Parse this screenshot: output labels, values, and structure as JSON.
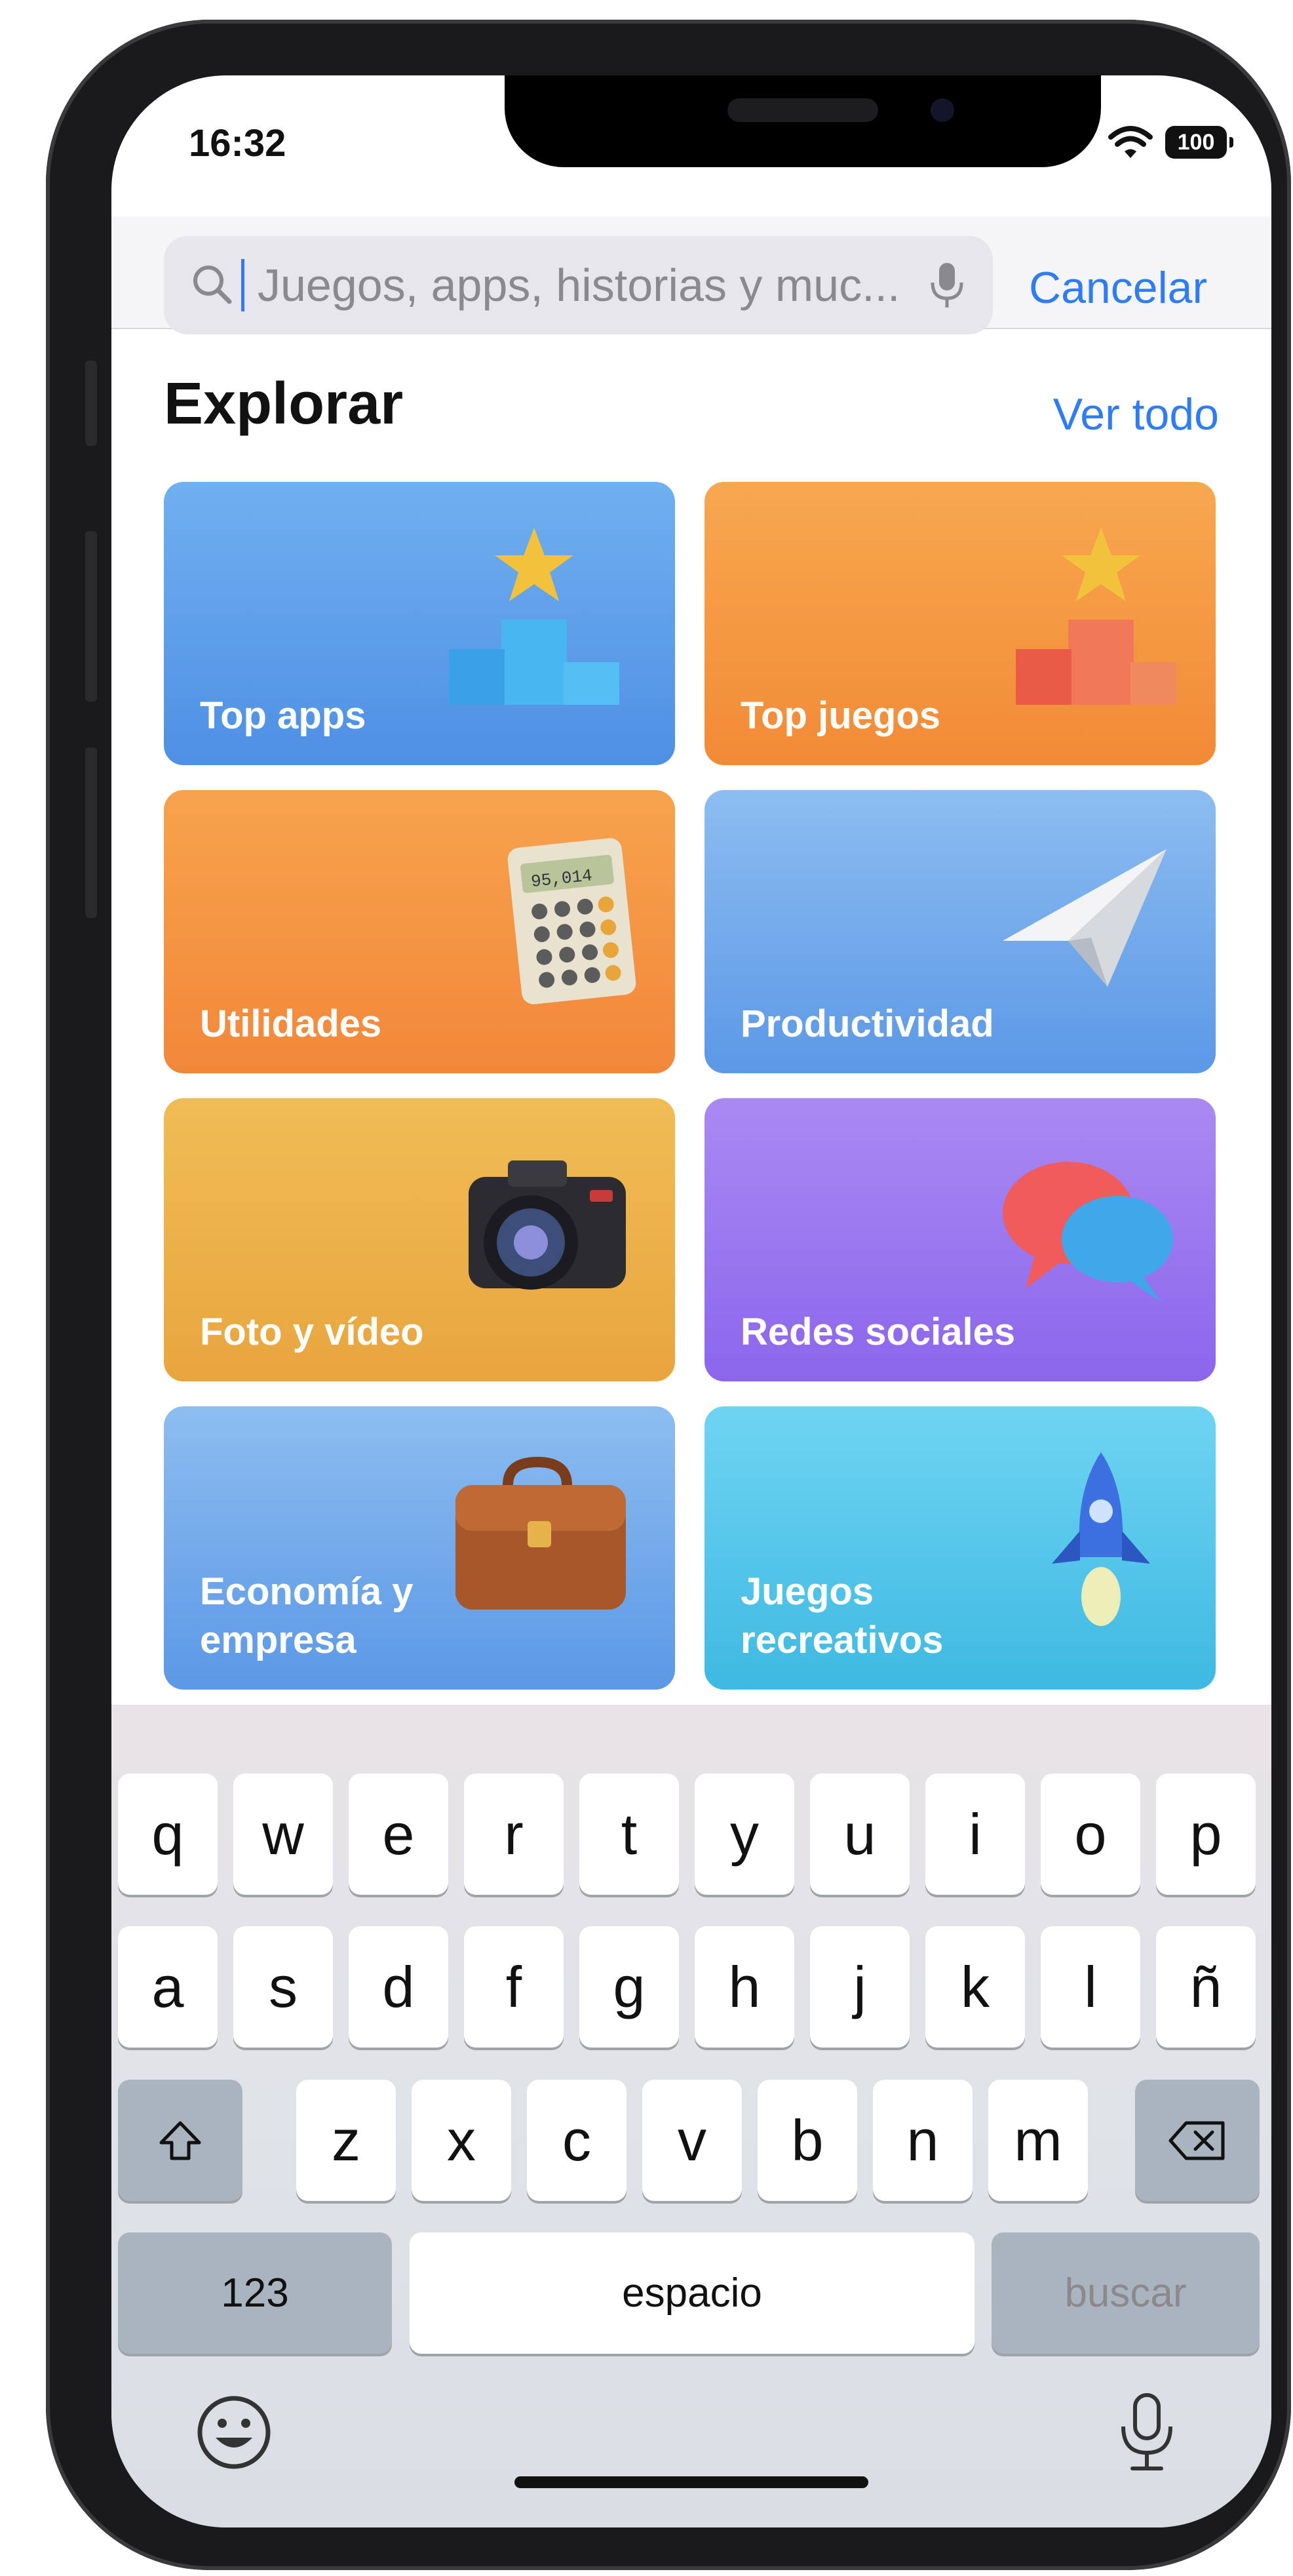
{
  "status_bar": {
    "time": "16:32",
    "battery": "100"
  },
  "search": {
    "placeholder": "Juegos, apps, historias y muc...",
    "cancel_label": "Cancelar"
  },
  "explore": {
    "title": "Explorar",
    "see_all_label": "Ver todo",
    "categories": [
      {
        "label": "Top apps",
        "icon": "podium-star-icon",
        "color": "#5b9be8"
      },
      {
        "label": "Top juegos",
        "icon": "podium-star-icon",
        "color": "#f29a3e"
      },
      {
        "label": "Utilidades",
        "icon": "calculator-icon",
        "color": "#f2943d",
        "icon_text": "95,014"
      },
      {
        "label": "Productividad",
        "icon": "paper-plane-icon",
        "color": "#6aa6ec"
      },
      {
        "label": "Foto y vídeo",
        "icon": "camera-icon",
        "color": "#eab04a"
      },
      {
        "label": "Redes sociales",
        "icon": "chat-bubbles-icon",
        "color": "#9a76ef"
      },
      {
        "label_line1": "Economía y",
        "label_line2": "empresa",
        "icon": "briefcase-icon",
        "color": "#6aa6ec"
      },
      {
        "label_line1": "Juegos",
        "label_line2": "recreativos",
        "icon": "rocket-icon",
        "color": "#4cc3e6"
      }
    ]
  },
  "keyboard": {
    "row1": [
      "q",
      "w",
      "e",
      "r",
      "t",
      "y",
      "u",
      "i",
      "o",
      "p"
    ],
    "row2": [
      "a",
      "s",
      "d",
      "f",
      "g",
      "h",
      "j",
      "k",
      "l",
      "ñ"
    ],
    "row3": [
      "z",
      "x",
      "c",
      "v",
      "b",
      "n",
      "m"
    ],
    "numbers_label": "123",
    "space_label": "espacio",
    "search_label": "buscar"
  }
}
